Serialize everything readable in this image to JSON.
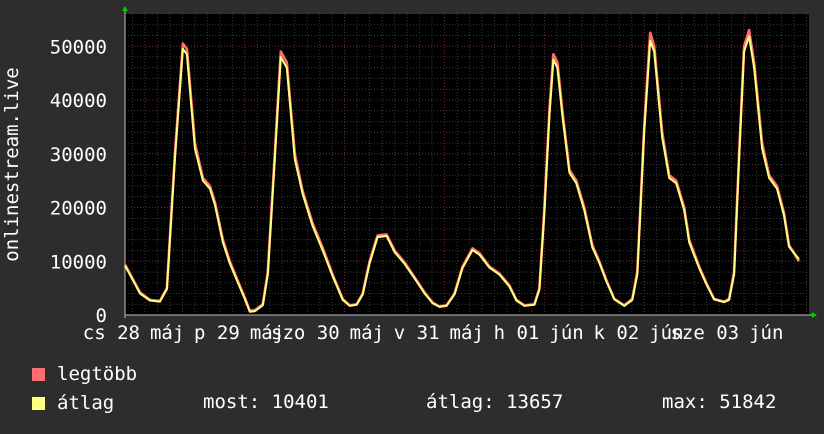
{
  "chart_data": {
    "type": "line",
    "ylabel": "onlinestream.live",
    "yticks": [
      0,
      10000,
      20000,
      30000,
      40000,
      50000
    ],
    "ylim": [
      0,
      56000
    ],
    "grid": true,
    "x_day_ticks": [
      "cs 28 máj",
      "p 29 máj",
      "szo 30 máj",
      "v 31 máj",
      "h 01 jún",
      "k 02 jún",
      "sze 03 jún"
    ],
    "x_tick_labels": [
      "cs 28",
      "máj",
      "p 29",
      "máj",
      "szo 30",
      "máj",
      "v 31",
      "máj",
      "h 01",
      "jún",
      "k 02",
      "jún",
      "sze 03",
      "jún"
    ],
    "x_day_range": [
      -0.2,
      6.65
    ],
    "series": [
      {
        "name": "legtöbb",
        "color": "#ff6e6e",
        "points": [
          [
            -0.2,
            9400
          ],
          [
            -0.05,
            4200
          ],
          [
            0.05,
            2800
          ],
          [
            0.15,
            2600
          ],
          [
            0.22,
            5000
          ],
          [
            0.3,
            30000
          ],
          [
            0.38,
            50500
          ],
          [
            0.42,
            49500
          ],
          [
            0.5,
            32000
          ],
          [
            0.58,
            25500
          ],
          [
            0.65,
            24000
          ],
          [
            0.7,
            21000
          ],
          [
            0.78,
            14000
          ],
          [
            0.85,
            10000
          ],
          [
            0.92,
            6800
          ],
          [
            1.0,
            3200
          ],
          [
            1.05,
            800
          ],
          [
            1.1,
            900
          ],
          [
            1.18,
            2000
          ],
          [
            1.23,
            8000
          ],
          [
            1.3,
            30000
          ],
          [
            1.36,
            49000
          ],
          [
            1.42,
            47000
          ],
          [
            1.5,
            30000
          ],
          [
            1.58,
            23000
          ],
          [
            1.68,
            17000
          ],
          [
            1.78,
            12500
          ],
          [
            1.88,
            7500
          ],
          [
            1.98,
            3000
          ],
          [
            2.05,
            1800
          ],
          [
            2.12,
            2000
          ],
          [
            2.18,
            4000
          ],
          [
            2.25,
            10000
          ],
          [
            2.33,
            14800
          ],
          [
            2.42,
            15000
          ],
          [
            2.5,
            12000
          ],
          [
            2.6,
            9800
          ],
          [
            2.7,
            7000
          ],
          [
            2.8,
            4200
          ],
          [
            2.88,
            2300
          ],
          [
            2.95,
            1600
          ],
          [
            3.02,
            1800
          ],
          [
            3.1,
            4000
          ],
          [
            3.18,
            9000
          ],
          [
            3.28,
            12400
          ],
          [
            3.35,
            11500
          ],
          [
            3.45,
            9000
          ],
          [
            3.55,
            7700
          ],
          [
            3.65,
            5500
          ],
          [
            3.72,
            2800
          ],
          [
            3.8,
            1800
          ],
          [
            3.9,
            2000
          ],
          [
            3.95,
            5000
          ],
          [
            4.0,
            20000
          ],
          [
            4.05,
            38000
          ],
          [
            4.09,
            48500
          ],
          [
            4.13,
            47000
          ],
          [
            4.18,
            38000
          ],
          [
            4.25,
            27000
          ],
          [
            4.32,
            25000
          ],
          [
            4.4,
            20000
          ],
          [
            4.48,
            13000
          ],
          [
            4.55,
            10000
          ],
          [
            4.62,
            6500
          ],
          [
            4.7,
            3000
          ],
          [
            4.8,
            1800
          ],
          [
            4.88,
            3000
          ],
          [
            4.93,
            8000
          ],
          [
            5.0,
            35000
          ],
          [
            5.06,
            52500
          ],
          [
            5.1,
            50000
          ],
          [
            5.18,
            34000
          ],
          [
            5.25,
            26000
          ],
          [
            5.32,
            25000
          ],
          [
            5.4,
            20000
          ],
          [
            5.45,
            14000
          ],
          [
            5.55,
            9000
          ],
          [
            5.62,
            6000
          ],
          [
            5.7,
            3000
          ],
          [
            5.8,
            2500
          ],
          [
            5.85,
            3000
          ],
          [
            5.9,
            8000
          ],
          [
            5.95,
            30000
          ],
          [
            6.0,
            50000
          ],
          [
            6.05,
            53000
          ],
          [
            6.1,
            47000
          ],
          [
            6.18,
            32000
          ],
          [
            6.25,
            26000
          ],
          [
            6.33,
            24000
          ],
          [
            6.4,
            19000
          ],
          [
            6.45,
            13000
          ],
          [
            6.55,
            10000
          ]
        ]
      },
      {
        "name": "átlag",
        "color": "#ffff80",
        "points": [
          [
            -0.2,
            9200
          ],
          [
            -0.05,
            4000
          ],
          [
            0.05,
            2700
          ],
          [
            0.15,
            2500
          ],
          [
            0.22,
            4800
          ],
          [
            0.3,
            29000
          ],
          [
            0.38,
            49500
          ],
          [
            0.42,
            48500
          ],
          [
            0.5,
            31000
          ],
          [
            0.58,
            25000
          ],
          [
            0.65,
            23500
          ],
          [
            0.7,
            20500
          ],
          [
            0.78,
            13500
          ],
          [
            0.85,
            9600
          ],
          [
            0.92,
            6500
          ],
          [
            1.0,
            3000
          ],
          [
            1.05,
            600
          ],
          [
            1.1,
            700
          ],
          [
            1.18,
            1800
          ],
          [
            1.23,
            7500
          ],
          [
            1.3,
            29000
          ],
          [
            1.36,
            48000
          ],
          [
            1.42,
            46000
          ],
          [
            1.5,
            29000
          ],
          [
            1.58,
            22500
          ],
          [
            1.68,
            16500
          ],
          [
            1.78,
            12000
          ],
          [
            1.88,
            7200
          ],
          [
            1.98,
            2800
          ],
          [
            2.05,
            1700
          ],
          [
            2.12,
            1900
          ],
          [
            2.18,
            3800
          ],
          [
            2.25,
            9600
          ],
          [
            2.33,
            14500
          ],
          [
            2.42,
            14700
          ],
          [
            2.5,
            11700
          ],
          [
            2.6,
            9500
          ],
          [
            2.7,
            6800
          ],
          [
            2.8,
            4000
          ],
          [
            2.88,
            2200
          ],
          [
            2.95,
            1500
          ],
          [
            3.02,
            1700
          ],
          [
            3.1,
            3800
          ],
          [
            3.18,
            8700
          ],
          [
            3.28,
            12100
          ],
          [
            3.35,
            11200
          ],
          [
            3.45,
            8800
          ],
          [
            3.55,
            7500
          ],
          [
            3.65,
            5300
          ],
          [
            3.72,
            2700
          ],
          [
            3.8,
            1700
          ],
          [
            3.9,
            1900
          ],
          [
            3.95,
            4700
          ],
          [
            4.0,
            19000
          ],
          [
            4.05,
            37000
          ],
          [
            4.09,
            47500
          ],
          [
            4.13,
            46000
          ],
          [
            4.18,
            37000
          ],
          [
            4.25,
            26500
          ],
          [
            4.32,
            24500
          ],
          [
            4.4,
            19500
          ],
          [
            4.48,
            12600
          ],
          [
            4.55,
            9700
          ],
          [
            4.62,
            6300
          ],
          [
            4.7,
            2900
          ],
          [
            4.8,
            1700
          ],
          [
            4.88,
            2800
          ],
          [
            4.93,
            7500
          ],
          [
            5.0,
            34000
          ],
          [
            5.06,
            51000
          ],
          [
            5.1,
            49000
          ],
          [
            5.18,
            33000
          ],
          [
            5.25,
            25500
          ],
          [
            5.32,
            24500
          ],
          [
            5.4,
            19500
          ],
          [
            5.45,
            13500
          ],
          [
            5.55,
            8700
          ],
          [
            5.62,
            5800
          ],
          [
            5.7,
            2900
          ],
          [
            5.8,
            2400
          ],
          [
            5.85,
            2800
          ],
          [
            5.9,
            7500
          ],
          [
            5.95,
            29000
          ],
          [
            6.0,
            49000
          ],
          [
            6.05,
            51842
          ],
          [
            6.1,
            46000
          ],
          [
            6.18,
            31000
          ],
          [
            6.25,
            25500
          ],
          [
            6.33,
            23500
          ],
          [
            6.4,
            18500
          ],
          [
            6.45,
            12700
          ],
          [
            6.55,
            10401
          ]
        ]
      }
    ],
    "legend": [
      {
        "label": "legtöbb",
        "color": "#ff6e6e"
      },
      {
        "label": "átlag",
        "color": "#ffff80"
      }
    ],
    "stats": {
      "most": "most: 10401",
      "atlag": "átlag: 13657",
      "max": "max: 51842"
    }
  }
}
